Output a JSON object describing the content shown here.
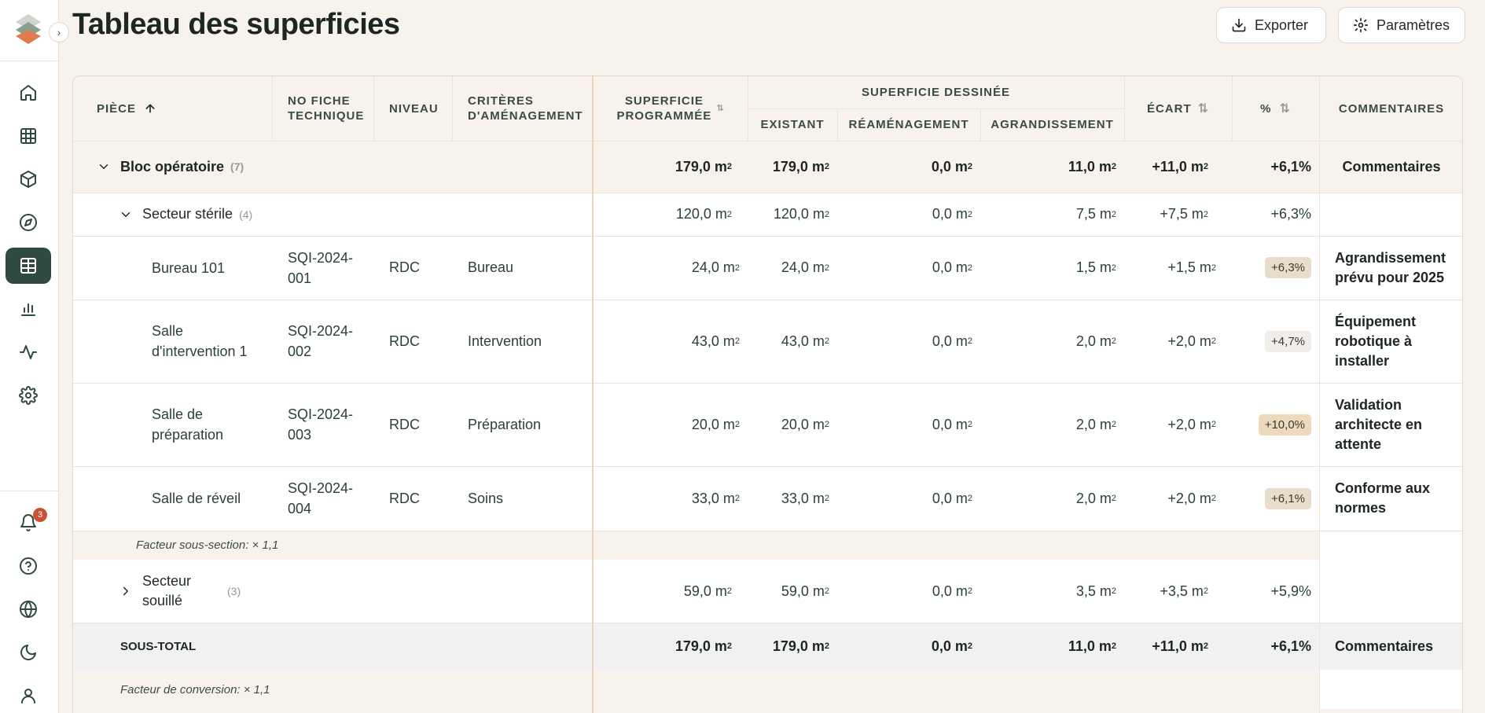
{
  "page": {
    "title": "Tableau des superficies"
  },
  "header": {
    "export_label": "Exporter",
    "settings_label": "Paramètres"
  },
  "sidebar": {
    "notifications_count": "3",
    "collapse_glyph": "›"
  },
  "table": {
    "headers": {
      "piece": "PIÈCE",
      "fiche": "NO FICHE\nTECHNIQUE",
      "niveau": "NIVEAU",
      "criteres": "CRITÈRES\nD'AMÉNAGEMENT",
      "programmee": "SUPERFICIE\nPROGRAMMÉE",
      "dessinee": "SUPERFICIE DESSINÉE",
      "existant": "EXISTANT",
      "reamenagement": "RÉAMÉNAGEMENT",
      "agrandissement": "AGRANDISSEMENT",
      "ecart": "ÉCART",
      "pct": "%",
      "commentaires": "COMMENTAIRES"
    },
    "unit": "m",
    "unit_sup": "2",
    "group": {
      "name": "Bloc opératoire",
      "count": "(7)",
      "programmee": "179,0 m",
      "existant": "179,0 m",
      "reamenagement": "0,0 m",
      "agrandissement": "11,0 m",
      "ecart": "+11,0 m",
      "pct": "+6,1%",
      "comment": "Commentaires"
    },
    "sector1": {
      "name": "Secteur stérile",
      "count": "(4)",
      "programmee": "120,0 m",
      "existant": "120,0 m",
      "reamenagement": "0,0 m",
      "agrandissement": "7,5 m",
      "ecart": "+7,5 m",
      "pct": "+6,3%"
    },
    "rows": [
      {
        "piece": "Bureau 101",
        "fiche": "SQI-2024-\n001",
        "niveau": "RDC",
        "criteres": "Bureau",
        "programmee": "24,0 m",
        "existant": "24,0 m",
        "reamenagement": "0,0 m",
        "agrandissement": "1,5 m",
        "ecart": "+1,5 m",
        "pct": "+6,3%",
        "pct_color": "#e8dccb",
        "comment": "Agrandissement\nprévu pour 2025"
      },
      {
        "piece": "Salle\nd'intervention 1",
        "fiche": "SQI-2024-\n002",
        "niveau": "RDC",
        "criteres": "Intervention",
        "programmee": "43,0 m",
        "existant": "43,0 m",
        "reamenagement": "0,0 m",
        "agrandissement": "2,0 m",
        "ecart": "+2,0 m",
        "pct": "+4,7%",
        "pct_color": "#f1eeea",
        "comment": "Équipement\nrobotique à\ninstaller"
      },
      {
        "piece": "Salle de\npréparation",
        "fiche": "SQI-2024-\n003",
        "niveau": "RDC",
        "criteres": "Préparation",
        "programmee": "20,0 m",
        "existant": "20,0 m",
        "reamenagement": "0,0 m",
        "agrandissement": "2,0 m",
        "ecart": "+2,0 m",
        "pct": "+10,0%",
        "pct_color": "#eed9bd",
        "comment": "Validation\narchitecte en\nattente"
      },
      {
        "piece": "Salle de réveil",
        "fiche": "SQI-2024-\n004",
        "niveau": "RDC",
        "criteres": "Soins",
        "programmee": "33,0 m",
        "existant": "33,0 m",
        "reamenagement": "0,0 m",
        "agrandissement": "2,0 m",
        "ecart": "+2,0 m",
        "pct": "+6,1%",
        "pct_color": "#e8dccb",
        "comment": "Conforme aux\nnormes"
      }
    ],
    "subsection_factor": "Facteur sous-section: × 1,1",
    "sector2": {
      "name": "Secteur\nsouillé",
      "count": "(3)",
      "programmee": "59,0 m",
      "existant": "59,0 m",
      "reamenagement": "0,0 m",
      "agrandissement": "3,5 m",
      "ecart": "+3,5 m",
      "pct": "+5,9%"
    },
    "subtotal": {
      "label": "SOUS-TOTAL",
      "programmee": "179,0 m",
      "existant": "179,0 m",
      "reamenagement": "0,0 m",
      "agrandissement": "11,0 m",
      "ecart": "+11,0 m",
      "pct": "+6,1%",
      "comment": "Commentaires"
    },
    "conversion_factor": "Facteur de conversion: × 1,1"
  }
}
